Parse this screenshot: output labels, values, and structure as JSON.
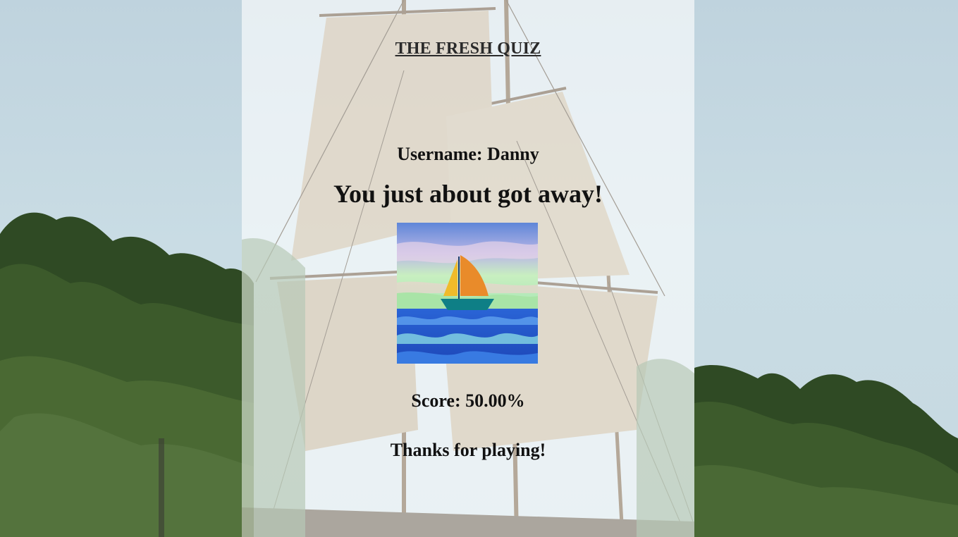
{
  "quiz": {
    "title": "THE FRESH QUIZ"
  },
  "result": {
    "username_label": "Username:",
    "username": "Danny",
    "headline": "You just about got away!",
    "score_label": "Score:",
    "score_value": "50.00%",
    "thanks": "Thanks for playing!"
  },
  "images": {
    "result_image": "sailboat-painting",
    "background": "tall-ship-with-trees"
  },
  "colors": {
    "panel_overlay": "#ffffffa0",
    "text": "#111111",
    "sail_orange": "#e98b2a",
    "sail_yellow": "#f0bb2b",
    "sea_blue": "#2c5fd0"
  }
}
